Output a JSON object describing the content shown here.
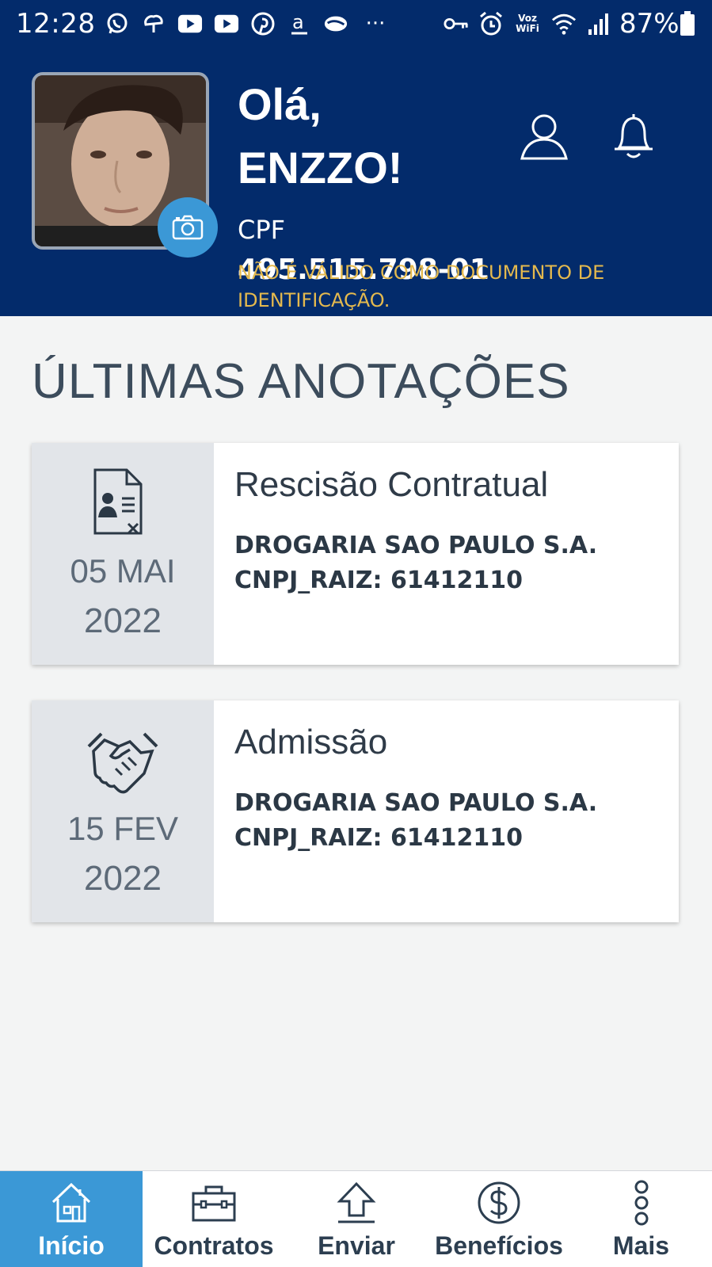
{
  "status_bar": {
    "time": "12:28",
    "battery": "87%",
    "left_icons": [
      "whatsapp-icon",
      "cloud-icon",
      "youtube-icon",
      "youtube-icon",
      "pinterest-icon",
      "amazon-icon",
      "chat-icon",
      "more-icon"
    ],
    "right_icons": [
      "key-icon",
      "alarm-icon",
      "voz-wifi-icon",
      "wifi-icon",
      "signal-icon"
    ],
    "voz_wifi_label": "Voz WiFi",
    "more_label": "···"
  },
  "header": {
    "greeting_line1": "Olá,",
    "greeting_line2": "ENZZO!",
    "cpf_label": "CPF",
    "cpf_value": "495.515.798-01",
    "disclaimer": "NÃO É VÁLIDO COMO DOCUMENTO DE IDENTIFICAÇÃO."
  },
  "section_title": "ÚLTIMAS ANOTAÇÕES",
  "cards": [
    {
      "icon": "document-cancel-icon",
      "date_day": "05 MAI",
      "date_year": "2022",
      "title": "Rescisão Contratual",
      "company": "DROGARIA SAO PAULO S.A.",
      "cnpj": "CNPJ_RAIZ: 61412110"
    },
    {
      "icon": "handshake-icon",
      "date_day": "15 FEV",
      "date_year": "2022",
      "title": "Admissão",
      "company": "DROGARIA SAO PAULO S.A.",
      "cnpj": "CNPJ_RAIZ: 61412110"
    }
  ],
  "bottom_nav": [
    {
      "label": "Início",
      "icon": "home-icon",
      "active": true
    },
    {
      "label": "Contratos",
      "icon": "briefcase-icon",
      "active": false
    },
    {
      "label": "Enviar",
      "icon": "upload-icon",
      "active": false
    },
    {
      "label": "Benefícios",
      "icon": "dollar-icon",
      "active": false
    },
    {
      "label": "Mais",
      "icon": "more-vertical-icon",
      "active": false
    }
  ],
  "colors": {
    "header_bg": "#032b6b",
    "accent": "#3b98d6",
    "disclaimer": "#e4b94e",
    "page_bg": "#f3f4f4"
  }
}
